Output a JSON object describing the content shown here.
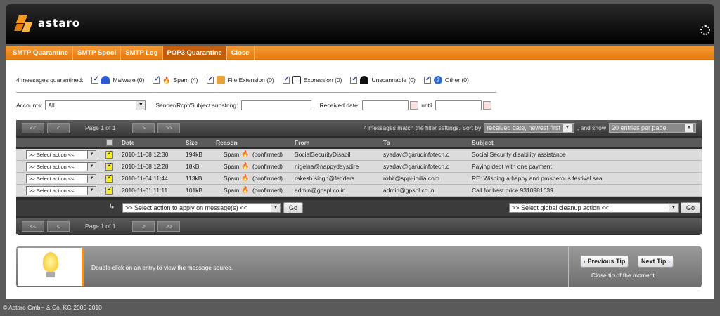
{
  "brand": {
    "name": "astaro"
  },
  "tabs": [
    "SMTP Quarantine",
    "SMTP Spool",
    "SMTP Log",
    "POP3 Quarantine",
    "Close"
  ],
  "quarantine": {
    "summary": "4 messages quarantined:",
    "items": [
      {
        "label": "Malware (0)",
        "icon": "malware-icon",
        "color": "#2a5bd0"
      },
      {
        "label": "Spam (4)",
        "icon": "flame-icon",
        "color": "#e96a10"
      },
      {
        "label": "File Extension (0)",
        "icon": "package-icon",
        "color": "#e6a23c"
      },
      {
        "label": "Expression (0)",
        "icon": "speech-bubble-icon",
        "color": "#333333"
      },
      {
        "label": "Unscannable (0)",
        "icon": "hat-icon",
        "color": "#111111"
      },
      {
        "label": "Other (0)",
        "icon": "help-icon",
        "color": "#2a6bd0"
      }
    ]
  },
  "filters": {
    "accounts_label": "Accounts:",
    "accounts_value": "All",
    "substring_label": "Sender/Rcpt/Subject substring:",
    "received_label": "Received date:",
    "until_label": "until"
  },
  "grid": {
    "page_text": "Page 1 of 1",
    "prev_first": "<<",
    "prev": "<",
    "next": ">",
    "next_last": ">>",
    "match_text": "4 messages match the filter settings. Sort by",
    "sort_value": "received date, newest first",
    "and_show": ", and show",
    "show_value": "20 entries per page.",
    "columns": {
      "date": "Date",
      "size": "Size",
      "reason": "Reason",
      "from": "From",
      "to": "To",
      "subject": "Subject"
    },
    "row_action": ">> Select action <<",
    "rows": [
      {
        "date": "2010-11-08 12:30",
        "size": "194kB",
        "reason": "Spam",
        "status": "(confirmed)",
        "from": "SocialSecurityDisabil",
        "to": "syadav@garudinfotech.c",
        "subject": "Social Security disability assistance"
      },
      {
        "date": "2010-11-08 12:28",
        "size": "18kB",
        "reason": "Spam",
        "status": "(confirmed)",
        "from": "nigelna@nappydaysdire",
        "to": "syadav@garudinfotech.c",
        "subject": "Paying debt with one payment"
      },
      {
        "date": "2010-11-04 11:44",
        "size": "113kB",
        "reason": "Spam",
        "status": "(confirmed)",
        "from": "rakesh.singh@fedders",
        "to": "rohit@sppl-india.com",
        "subject": "RE: Wishing a happy and prosperous festival sea"
      },
      {
        "date": "2010-11-01 11:11",
        "size": "101kB",
        "reason": "Spam",
        "status": "(confirmed)",
        "from": "admin@gpspl.co.in",
        "to": "admin@gpspl.co.in",
        "subject": "Call for best price 9310981639"
      }
    ],
    "bulk_action": ">> Select action to apply on message(s) <<",
    "go": "Go",
    "global_action": ">> Select global cleanup action <<"
  },
  "tip": {
    "text": "Double-click on an entry to view the message source.",
    "prev": "Previous Tip",
    "next": "Next Tip",
    "close": "Close tip of the moment"
  },
  "footer": "© Astaro GmbH & Co. KG 2000-2010"
}
